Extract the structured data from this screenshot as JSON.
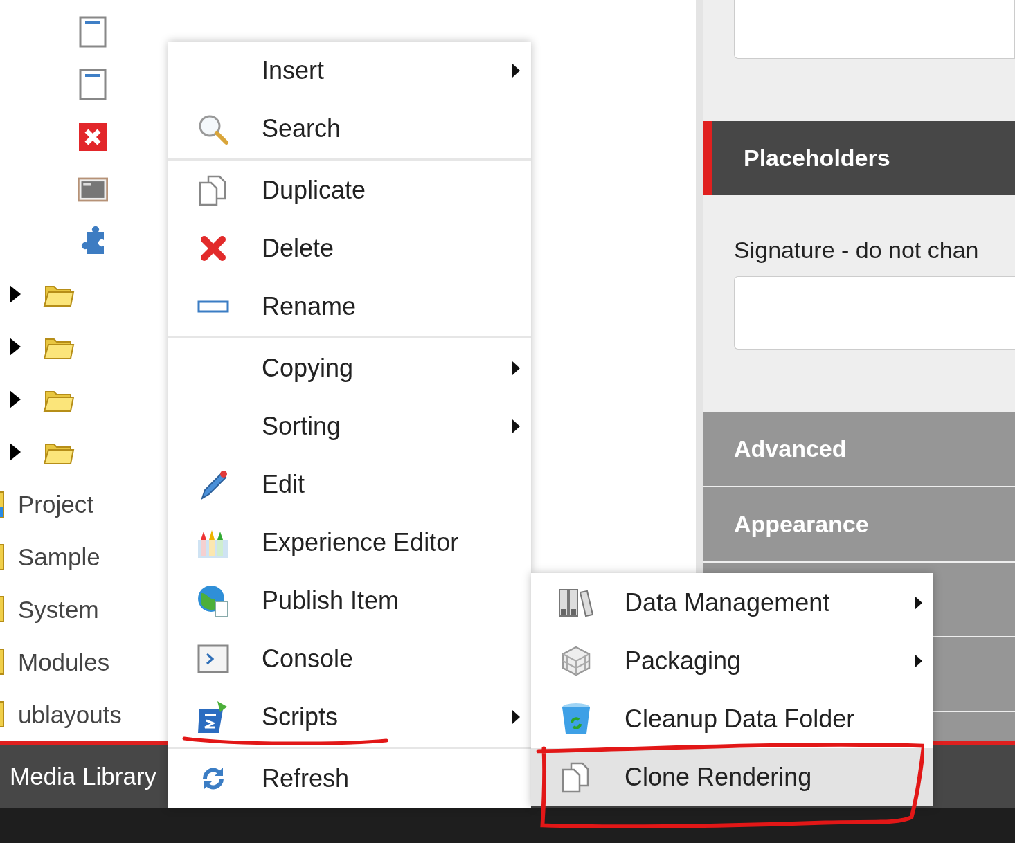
{
  "tree": {
    "items": [
      {
        "kind": "page"
      },
      {
        "kind": "page"
      },
      {
        "kind": "error"
      },
      {
        "kind": "textbox"
      },
      {
        "kind": "puzzle"
      },
      {
        "kind": "folder",
        "expandable": true
      },
      {
        "kind": "folder",
        "expandable": true
      },
      {
        "kind": "folder",
        "expandable": true
      },
      {
        "kind": "folder",
        "expandable": true
      },
      {
        "kind": "label",
        "label": "Project",
        "badge": true
      },
      {
        "kind": "label",
        "label": "Sample",
        "badge": false
      },
      {
        "kind": "label",
        "label": "System",
        "badge": false
      },
      {
        "kind": "label",
        "label": "Modules",
        "badge": false
      },
      {
        "kind": "label",
        "label": "ublayouts",
        "badge": false
      }
    ]
  },
  "bottom_bar": {
    "label": "Media Library"
  },
  "context_menu": {
    "groups": [
      [
        {
          "label": "Insert",
          "kind": "none",
          "submenu": true
        },
        {
          "label": "Search",
          "kind": "search",
          "submenu": false
        }
      ],
      [
        {
          "label": "Duplicate",
          "kind": "duplicate",
          "submenu": false
        },
        {
          "label": "Delete",
          "kind": "delete",
          "submenu": false
        },
        {
          "label": "Rename",
          "kind": "rename",
          "submenu": false
        }
      ],
      [
        {
          "label": "Copying",
          "kind": "none",
          "submenu": true
        },
        {
          "label": "Sorting",
          "kind": "none",
          "submenu": true
        },
        {
          "label": "Edit",
          "kind": "edit",
          "submenu": false
        },
        {
          "label": "Experience Editor",
          "kind": "experience",
          "submenu": false
        },
        {
          "label": "Publish Item",
          "kind": "publish",
          "submenu": false
        },
        {
          "label": "Console",
          "kind": "console",
          "submenu": false
        },
        {
          "label": "Scripts",
          "kind": "scripts",
          "submenu": true
        }
      ],
      [
        {
          "label": "Refresh",
          "kind": "refresh",
          "submenu": false
        }
      ]
    ]
  },
  "submenu": {
    "items": [
      {
        "label": "Data Management",
        "kind": "binders",
        "submenu": true,
        "selected": false
      },
      {
        "label": "Packaging",
        "kind": "cube",
        "submenu": true,
        "selected": false
      },
      {
        "label": "Cleanup Data Folder",
        "kind": "bin",
        "submenu": false,
        "selected": false
      },
      {
        "label": "Clone Rendering",
        "kind": "duplicate",
        "submenu": false,
        "selected": true
      }
    ]
  },
  "editor": {
    "sections": [
      {
        "title": "Placeholders",
        "expanded": true,
        "field": {
          "label": "Signature - do not chan"
        }
      },
      {
        "title": "Advanced",
        "expanded": false
      },
      {
        "title": "Appearance",
        "expanded": false
      }
    ]
  }
}
